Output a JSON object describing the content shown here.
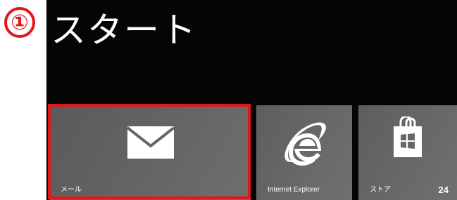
{
  "step_marker": "①",
  "screen": {
    "title": "スタート"
  },
  "tiles": [
    {
      "label": "メール",
      "icon": "mail-icon",
      "selected": true
    },
    {
      "label": "Internet Explorer",
      "icon": "internet-explorer-icon"
    },
    {
      "label": "ストア",
      "icon": "store-icon",
      "badge": "24"
    }
  ],
  "colors": {
    "highlight": "#e3171b",
    "screen_background": "#050505",
    "tile_background": "#666666"
  }
}
